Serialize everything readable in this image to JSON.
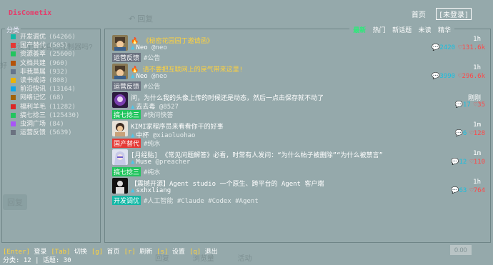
{
  "app": {
    "title": "DisCometix"
  },
  "nav": {
    "home": "首页",
    "login": "[未登录]"
  },
  "ghost": {
    "reply": "回复",
    "notice": "还没有分享自己控制器吗?",
    "notice_prefix": "好",
    "bottom_reply": "回复",
    "stats": "回复 浏览量 活动",
    "zero": "0.00"
  },
  "categories": {
    "title": "分类",
    "items": [
      {
        "label": "开发调优",
        "count": "(64266)",
        "color": "#14b8a6"
      },
      {
        "label": "国产替代",
        "count": "(505)",
        "color": "#e53935"
      },
      {
        "label": "资源荟萃",
        "count": "(25600)",
        "color": "#22c55e"
      },
      {
        "label": "文档共建",
        "count": "(960)",
        "color": "#b45309"
      },
      {
        "label": "非我莫属",
        "count": "(932)",
        "color": "#64748b"
      },
      {
        "label": "读书成诗",
        "count": "(808)",
        "color": "#eab308"
      },
      {
        "label": "前沿快讯",
        "count": "(13164)",
        "color": "#0ea5e9"
      },
      {
        "label": "网络记忆",
        "count": "(68)",
        "color": "#a16207"
      },
      {
        "label": "福利羊毛",
        "count": "(11282)",
        "color": "#dc2626"
      },
      {
        "label": "搞七捻三",
        "count": "(125430)",
        "color": "#22c55e"
      },
      {
        "label": "虫洞广场",
        "count": "(84)",
        "color": "#a855f7"
      },
      {
        "label": "运营反馈",
        "count": "(5639)",
        "color": "#6b7280"
      }
    ]
  },
  "tabs": {
    "latest": "最新",
    "hot": "热门",
    "new": "新话题",
    "unread": "未读",
    "top": "精华"
  },
  "topics": [
    {
      "prefix": "🔥",
      "title": "《秘密花园园丁邀请函》",
      "author": "Neo",
      "handle": "@neo",
      "badge": "运营反馈",
      "badge_color": "#6b7280",
      "tags": "#公告",
      "time": "1h",
      "replies": "2420",
      "likes": "131.6k"
    },
    {
      "prefix": "🔥",
      "title": "请不要把互联网上的戾气带来这里!",
      "author": "Neo",
      "handle": "@neo",
      "badge": "运营反馈",
      "badge_color": "#6b7280",
      "tags": "#公告",
      "time": "1h",
      "replies": "3990",
      "likes": "296.6k"
    },
    {
      "prefix": "",
      "title": "问，为什么我的头像上传的时候还是动态，然后一点击保存就不动了",
      "author": "去去毒",
      "handle": "@8527",
      "badge": "搞七捻三",
      "badge_color": "#22c55e",
      "tags": "#快问快答",
      "time": "刚刚",
      "replies": "17",
      "likes": "35"
    },
    {
      "prefix": "",
      "title": "KIMI家程序员来看看你干的好事",
      "author": "中杯",
      "handle": "@xiaoluohao",
      "badge": "国产替代",
      "badge_color": "#e53935",
      "tags": "#纯水",
      "time": "1m",
      "replies": "6",
      "likes": "128"
    },
    {
      "prefix": "",
      "title": "[月经贴] 《常见问题解答》必看，时常有人发问：“为什么帖子被删除”“为什么被禁言”",
      "author": "Muse",
      "handle": "@preacher",
      "badge": "搞七捻三",
      "badge_color": "#22c55e",
      "tags": "#纯水",
      "time": "1m",
      "replies": "12",
      "likes": "110"
    },
    {
      "prefix": "",
      "title": "【震撼开源】Agent studio 一个原生、跨平台的 Agent 客户端",
      "author": "sxhxliang",
      "handle": "",
      "badge": "开发调优",
      "badge_color": "#14b8a6",
      "tags": "#人工智能 #Claude #Codex #Agent",
      "time": "1h",
      "replies": "63",
      "likes": "764"
    }
  ],
  "hints": [
    {
      "key": "[Enter]",
      "label": "登录"
    },
    {
      "key": "[Tab]",
      "label": "切换"
    },
    {
      "key": "[g]",
      "label": "首页"
    },
    {
      "key": "[r]",
      "label": "刷新"
    },
    {
      "key": "[s]",
      "label": "设置"
    },
    {
      "key": "[q]",
      "label": "退出"
    }
  ],
  "status": {
    "text": "分类: 12 | 话题: 30"
  },
  "icons": {
    "reply": "speech-bubble-icon",
    "heart": "heart-icon",
    "user": "user-icon",
    "fire": "fire-icon"
  }
}
